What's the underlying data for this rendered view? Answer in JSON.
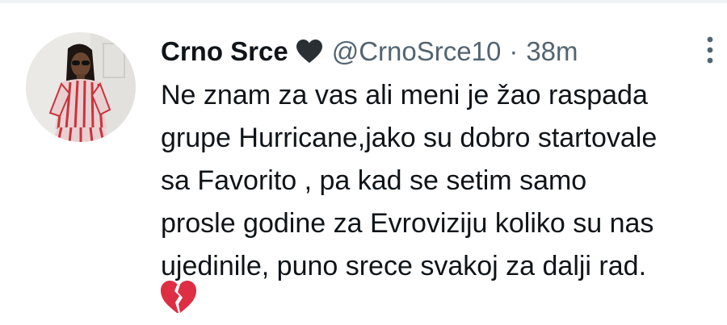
{
  "tweet": {
    "display_name": "Crno Srce",
    "name_emoji": "black-heart-icon",
    "handle": "@CrnoSrce10",
    "separator": "·",
    "time": "38m",
    "text_lines": [
      "Ne znam za vas ali meni je žao raspada",
      "grupe Hurricane,jako su dobro startovale",
      "sa Favorito , pa kad se setim samo",
      "prosle godine za Evroviziju koliko su nas",
      "ujedinile, puno srece svakoj za dalji rad."
    ],
    "trailing_emoji": "broken-heart-icon"
  },
  "colors": {
    "text_primary": "#0f1419",
    "text_secondary": "#536471",
    "broken_heart": "#dd2e44",
    "divider": "#eff3f4"
  }
}
